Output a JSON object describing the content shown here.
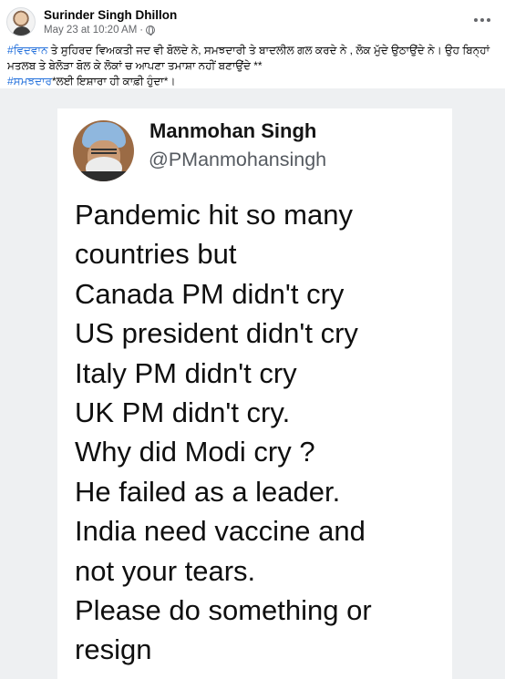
{
  "post": {
    "author": "Surinder Singh Dhillon",
    "timestamp": "May 23 at 10:20 AM",
    "separator": "·",
    "caption": {
      "hashtag1": "#ਵਿਦਵਾਨ",
      "text1": " ਤੇ ਸੁਹਿਰਦ ਵਿਅਕਤੀ ਜਦ ਵੀ ਬੋਲਦੇ ਨੇ, ਸਮਝਦਾਰੀ ਤੇ ਬਾਦਲੀਲ ਗਲ ਕਰਦੇ ਨੇ , ਲੋਕ ਮੁੱਦੇ ਉਠਾਉਂਦੇ ਨੇ। ਉਹ ਬਿਨ੍ਹਾਂ ਮਤਲਬ ਤੇ ਬੇਲੋੜਾ ਬੋਲ ਕੇ ਲੋਕਾਂ ਚ ਆਪਣਾ ਤਮਾਸ਼ਾ ਨਹੀਂ ਬਣਾਉਂਦੇ **",
      "hashtag2": "#ਸਮਝਦਾਰ",
      "text2": "*ਲਈ ਇਸ਼ਾਰਾ ਹੀ ਕਾਫ਼ੀ ਹੁੰਦਾ*।"
    }
  },
  "icons": {
    "privacy": "globe-icon",
    "more": "more-options-icon"
  },
  "tweet": {
    "name": "Manmohan Singh",
    "handle": "@PManmohansingh",
    "lines": [
      "Pandemic hit so many",
      "countries but",
      "Canada PM didn't cry",
      "US president didn't cry",
      "Italy PM didn't cry",
      "UK PM didn't cry.",
      "Why did Modi cry ?",
      "He failed as a leader.",
      "India need vaccine and",
      "not your tears.",
      "Please do something or",
      "resign"
    ]
  },
  "colors": {
    "hashtag": "#216fdb",
    "meta_text": "#65676b"
  }
}
